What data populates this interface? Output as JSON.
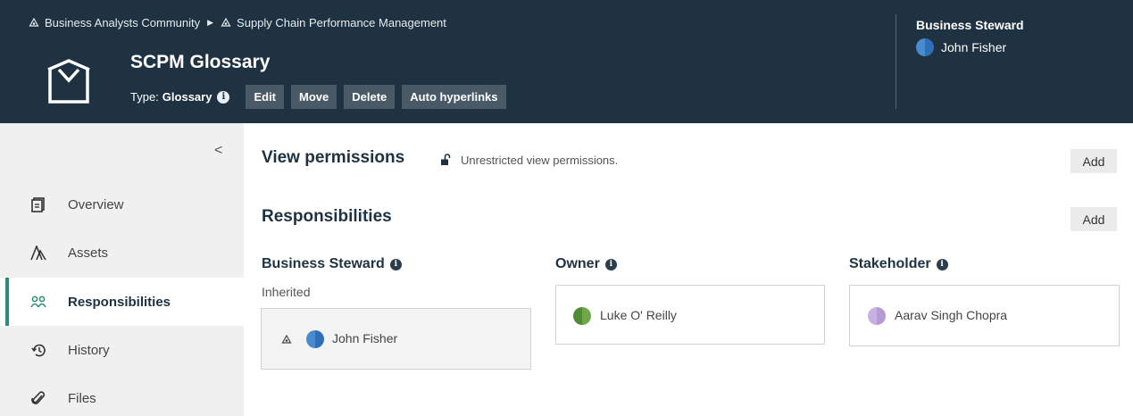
{
  "header": {
    "breadcrumb": [
      {
        "label": "Business Analysts Community",
        "icon": "community-icon"
      },
      {
        "label": "Supply Chain Performance Management",
        "icon": "community-icon"
      }
    ],
    "title": "SCPM Glossary",
    "type_label": "Type:",
    "type_value": "Glossary",
    "info_glyph": "i",
    "buttons": {
      "edit": "Edit",
      "move": "Move",
      "delete": "Delete",
      "auto_hyperlinks": "Auto hyperlinks"
    },
    "steward_label": "Business Steward",
    "steward_name": "John Fisher"
  },
  "sidebar": {
    "collapse_glyph": "<",
    "items": [
      {
        "label": "Overview",
        "icon": "overview-icon"
      },
      {
        "label": "Assets",
        "icon": "assets-icon"
      },
      {
        "label": "Responsibilities",
        "icon": "responsibilities-icon",
        "active": true
      },
      {
        "label": "History",
        "icon": "history-icon"
      },
      {
        "label": "Files",
        "icon": "paperclip-icon"
      }
    ]
  },
  "main": {
    "view_permissions": {
      "title": "View permissions",
      "note": "Unrestricted view permissions.",
      "add_label": "Add"
    },
    "responsibilities": {
      "title": "Responsibilities",
      "add_label": "Add",
      "roles": [
        {
          "title": "Business Steward",
          "inherited_label": "Inherited",
          "user": "John Fisher"
        },
        {
          "title": "Owner",
          "user": "Luke O' Reilly"
        },
        {
          "title": "Stakeholder",
          "user": "Aarav Singh Chopra"
        }
      ]
    }
  },
  "colors": {
    "header_bg": "#1e3241",
    "accent": "#2d8b7a",
    "button_bg": "#495a66"
  }
}
